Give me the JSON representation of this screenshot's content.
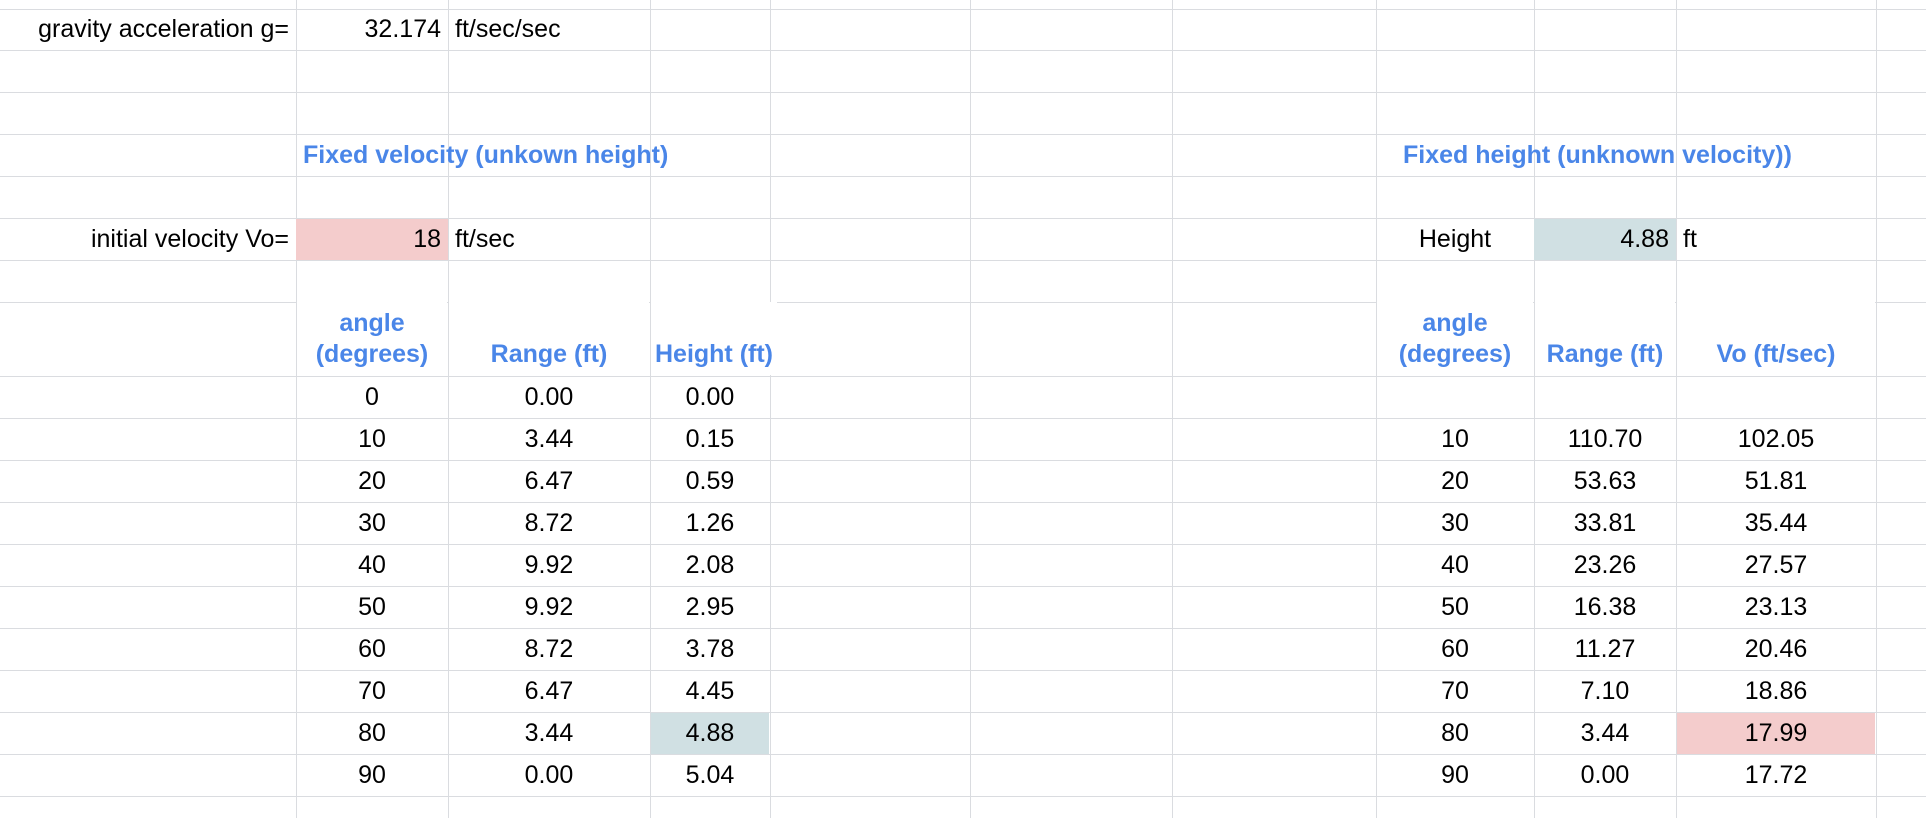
{
  "gravity": {
    "label": "gravity acceleration g=",
    "value": "32.174",
    "unit": "ft/sec/sec"
  },
  "fixed_velocity": {
    "title": "Fixed velocity (unkown height)",
    "input_label": "initial velocity Vo=",
    "input_value": "18",
    "input_unit": "ft/sec",
    "headers": {
      "angle_line1": "angle",
      "angle_line2": "(degrees)",
      "range": "Range (ft)",
      "height": "Height (ft)"
    },
    "rows": [
      {
        "angle": "0",
        "range": "0.00",
        "height": "0.00"
      },
      {
        "angle": "10",
        "range": "3.44",
        "height": "0.15"
      },
      {
        "angle": "20",
        "range": "6.47",
        "height": "0.59"
      },
      {
        "angle": "30",
        "range": "8.72",
        "height": "1.26"
      },
      {
        "angle": "40",
        "range": "9.92",
        "height": "2.08"
      },
      {
        "angle": "50",
        "range": "9.92",
        "height": "2.95"
      },
      {
        "angle": "60",
        "range": "8.72",
        "height": "3.78"
      },
      {
        "angle": "70",
        "range": "6.47",
        "height": "4.45"
      },
      {
        "angle": "80",
        "range": "3.44",
        "height": "4.88"
      },
      {
        "angle": "90",
        "range": "0.00",
        "height": "5.04"
      }
    ],
    "highlight_row": 8
  },
  "fixed_height": {
    "title": "Fixed height (unknown velocity))",
    "input_label": "Height",
    "input_value": "4.88",
    "input_unit": "ft",
    "headers": {
      "angle_line1": "angle",
      "angle_line2": "(degrees)",
      "range": "Range (ft)",
      "vo": "Vo (ft/sec)"
    },
    "rows": [
      {
        "angle": "",
        "range": "",
        "vo": ""
      },
      {
        "angle": "10",
        "range": "110.70",
        "vo": "102.05"
      },
      {
        "angle": "20",
        "range": "53.63",
        "vo": "51.81"
      },
      {
        "angle": "30",
        "range": "33.81",
        "vo": "35.44"
      },
      {
        "angle": "40",
        "range": "23.26",
        "vo": "27.57"
      },
      {
        "angle": "50",
        "range": "16.38",
        "vo": "23.13"
      },
      {
        "angle": "60",
        "range": "11.27",
        "vo": "20.46"
      },
      {
        "angle": "70",
        "range": "7.10",
        "vo": "18.86"
      },
      {
        "angle": "80",
        "range": "3.44",
        "vo": "17.99"
      },
      {
        "angle": "90",
        "range": "0.00",
        "vo": "17.72"
      }
    ],
    "highlight_row": 8
  },
  "colors": {
    "header_blue": "#4a86e8",
    "input_pink": "#f4cccc",
    "input_blue": "#d0e0e3",
    "gridline": "#dadce0"
  }
}
